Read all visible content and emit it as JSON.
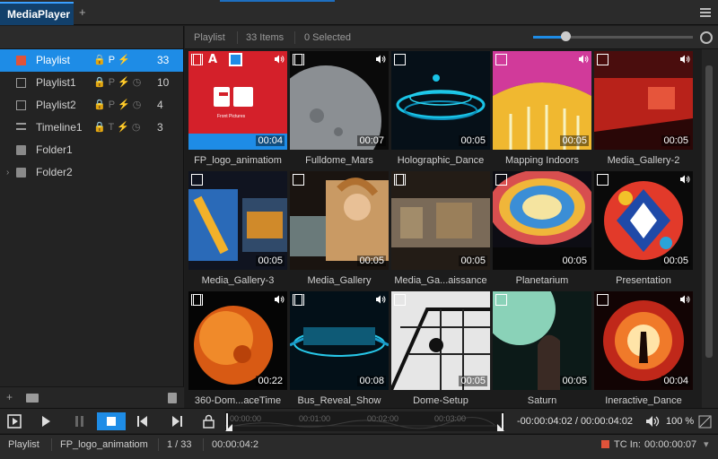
{
  "tabs": {
    "active": "MediaPlayer",
    "add": "+"
  },
  "sidebar": {
    "items": [
      {
        "label": "Playlist",
        "flags": "🔒 P ⚡",
        "count": "33",
        "selected": true,
        "icon": "playlist-red-icon"
      },
      {
        "label": "Playlist1",
        "flags": "🔒 P ⚡ ◷",
        "count": "10",
        "icon": "playlist-icon"
      },
      {
        "label": "Playlist2",
        "flags": "🔒 P ⚡ ◷",
        "count": "4",
        "icon": "playlist-icon"
      },
      {
        "label": "Timeline1",
        "flags": "🔒 T ⚡ ◷",
        "count": "3",
        "icon": "timeline-icon"
      },
      {
        "label": "Folder1",
        "icon": "folder-icon"
      },
      {
        "label": "Folder2",
        "icon": "folder-icon",
        "expander": "›"
      }
    ],
    "footer_add": "+"
  },
  "mainbar": {
    "title": "Playlist",
    "items": "33 Items",
    "selected": "0 Selected",
    "zoom": 0.2
  },
  "grid": {
    "items": [
      {
        "label": "FP_logo_animatiom",
        "duration": "00:04",
        "type": "film",
        "selected": true
      },
      {
        "label": "Fulldome_Mars",
        "duration": "00:07",
        "type": "film"
      },
      {
        "label": "Holographic_Dance",
        "duration": "00:05",
        "type": "image"
      },
      {
        "label": "Mapping Indoors",
        "duration": "00:05",
        "type": "image"
      },
      {
        "label": "Media_Gallery-2",
        "duration": "00:05",
        "type": "image"
      },
      {
        "label": "Media_Gallery-3",
        "duration": "00:05",
        "type": "image"
      },
      {
        "label": "Media_Gallery",
        "duration": "00:05",
        "type": "image"
      },
      {
        "label": "Media_Ga...aissance",
        "duration": "00:05",
        "type": "film"
      },
      {
        "label": "Planetarium",
        "duration": "00:05",
        "type": "image"
      },
      {
        "label": "Presentation",
        "duration": "00:05",
        "type": "image"
      },
      {
        "label": "360-Dom...aceTime",
        "duration": "00:22",
        "type": "film"
      },
      {
        "label": "Bus_Reveal_Show",
        "duration": "00:08",
        "type": "film"
      },
      {
        "label": "Dome-Setup",
        "duration": "00:05",
        "type": "image"
      },
      {
        "label": "Saturn",
        "duration": "00:05",
        "type": "image"
      },
      {
        "label": "Ineractive_Dance",
        "duration": "00:04",
        "type": "image"
      }
    ],
    "logo_text": "Front Pictures"
  },
  "transport": {
    "ticks": [
      "00:00:00",
      "00:01:00",
      "00:02:00",
      "00:03:00"
    ],
    "time": "-00:00:04:02 / 00:00:04:02",
    "volume": "100 %"
  },
  "status": {
    "list": "Playlist",
    "clip": "FP_logo_animatiom",
    "position": "1 / 33",
    "time": "00:00:04:2",
    "tc_label": "TC In:",
    "tc_value": "00:00:00:07"
  },
  "colors": {
    "accent": "#1e8ce6",
    "red": "#e0533a",
    "bg": "#1e1e1e"
  }
}
